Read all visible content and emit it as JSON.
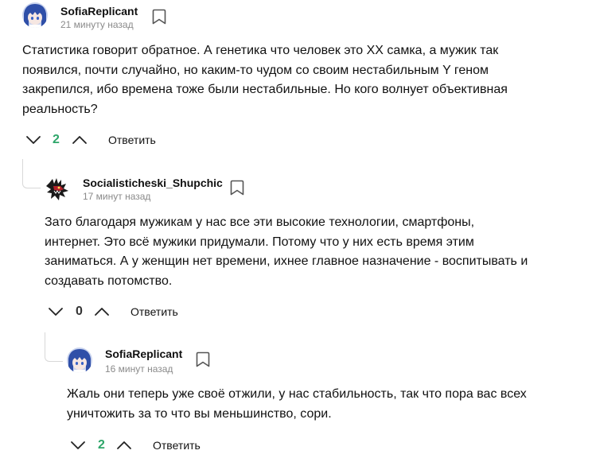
{
  "comments": [
    {
      "author": "SofiaReplicant",
      "time": "21 минуту назад",
      "text": "Статистика говорит обратное. А генетика что человек это XX самка, а мужик так появился, почти случайно, но каким-то чудом со своим нестабильным Y геном закрепился, ибо времена тоже были нестабильные. Но кого волнует объективная реальность?",
      "rating": "2",
      "reply_label": "Ответить",
      "avatar_icon": "anime-avatar-icon"
    },
    {
      "author": "Socialisticheski_Shupchic",
      "time": "17 минут назад",
      "text": "Зато благодаря мужикам у нас все эти высокие технологии, смартфоны, интернет. Это всё мужики придумали. Потому что у них есть время этим заниматься. А у женщин нет времени, ихнее главное назначение - воспитывать и создавать потомство.",
      "rating": "0",
      "reply_label": "Ответить",
      "avatar_icon": "dragon-avatar-icon"
    },
    {
      "author": "SofiaReplicant",
      "time": "16 минут назад",
      "text": "Жаль они теперь уже своё отжили, у нас стабильность, так что пора вас всех уничтожить за то что вы меньшинство, сори.",
      "rating": "2",
      "reply_label": "Ответить",
      "avatar_icon": "anime-avatar-icon"
    }
  ],
  "colors": {
    "positive_rating": "#2ea66a",
    "neutral_rating": "#333333",
    "timestamp": "#8a8a8a",
    "thread_line": "#d8d8d8"
  }
}
